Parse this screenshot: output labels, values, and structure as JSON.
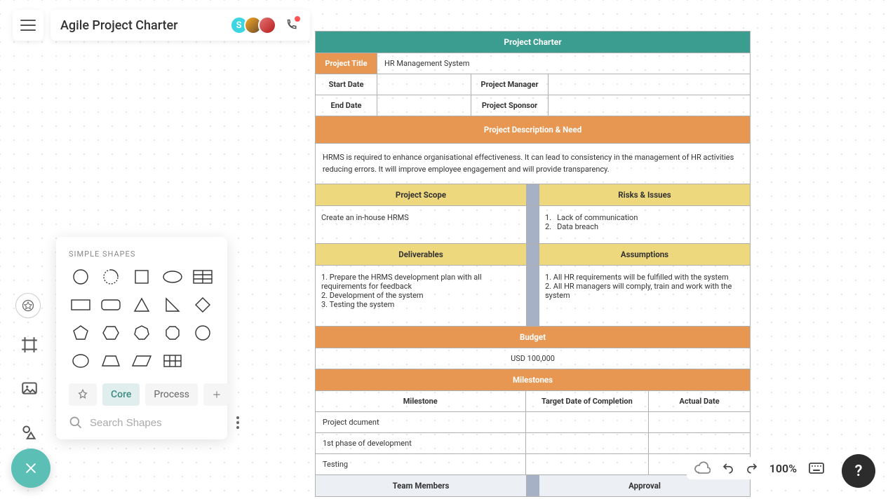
{
  "header": {
    "doc_title": "Agile Project Charter",
    "avatars": [
      {
        "initial": "S"
      }
    ]
  },
  "shapes_panel": {
    "label": "SIMPLE SHAPES",
    "tabs": {
      "core": "Core",
      "process": "Process"
    },
    "search_placeholder": "Search Shapes"
  },
  "charter": {
    "title_header": "Project Charter",
    "project_title_label": "Project Title",
    "project_title_value": "HR Management System",
    "start_date_label": "Start Date",
    "start_date_value": "",
    "project_manager_label": "Project Manager",
    "project_manager_value": "",
    "end_date_label": "End Date",
    "end_date_value": "",
    "project_sponsor_label": "Project Sponsor",
    "project_sponsor_value": "",
    "desc_header": "Project Description & Need",
    "desc_body": "HRMS is required to enhance organisational effectiveness. It can lead to consistency in the management of HR activities reducing errors. It will improve employee engagement and will provide transparency.",
    "scope_header": "Project Scope",
    "risks_header": "Risks & Issues",
    "scope_body": "Create an in-house HRMS",
    "risk1": "Lack of communication",
    "risk2": "Data breach",
    "deliverables_header": "Deliverables",
    "assumptions_header": "Assumptions",
    "deliv1": "1. Prepare the HRMS development plan with all requirements for feedback",
    "deliv2": "2. Development of the system",
    "deliv3": "3. Testing the system",
    "assump1": "1. All HR requirements will be fulfilled with the system",
    "assump2": "2. All HR managers will comply, train and work with the system",
    "budget_header": "Budget",
    "budget_value": "USD 100,000",
    "milestones_header": "Milestones",
    "ms_col1": "Milestone",
    "ms_col2": "Target Date of Completion",
    "ms_col3": "Actual Date",
    "ms_row1": "Project dcument",
    "ms_row2": "1st phase of development",
    "ms_row3": "Testing",
    "team_header": "Team Members",
    "approval_header": "Approval"
  },
  "footer": {
    "zoom": "100%"
  }
}
